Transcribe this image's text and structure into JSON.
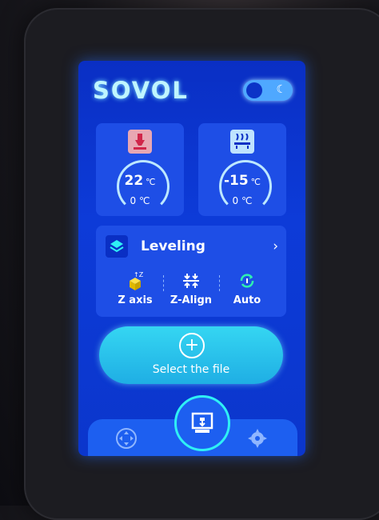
{
  "header": {
    "logo_text": "SOVOL",
    "theme_toggle_icon": "moon-icon"
  },
  "nozzle": {
    "icon": "nozzle-icon",
    "current_temp": "22",
    "unit": "℃",
    "target_temp": "0",
    "target_unit": "℃"
  },
  "bed": {
    "icon": "heated-bed-icon",
    "current_temp": "-15",
    "unit": "℃",
    "target_temp": "0",
    "target_unit": "℃"
  },
  "leveling": {
    "title": "Leveling",
    "chevron": "›",
    "buttons": [
      {
        "label": "Z axis",
        "icon": "z-axis-icon"
      },
      {
        "label": "Z-Align",
        "icon": "z-align-icon"
      },
      {
        "label": "Auto",
        "icon": "auto-level-icon"
      }
    ]
  },
  "select_file": {
    "label": "Select the file",
    "icon": "plus-icon"
  },
  "nav": {
    "left_icon": "move-icon",
    "center_icon": "print-icon",
    "right_icon": "settings-icon"
  },
  "colors": {
    "screen_bg": "#0d3bd8",
    "card_bg": "#1e4ee6",
    "accent_cyan": "#2ff0f5",
    "button_gradient_top": "#35d6f2"
  }
}
